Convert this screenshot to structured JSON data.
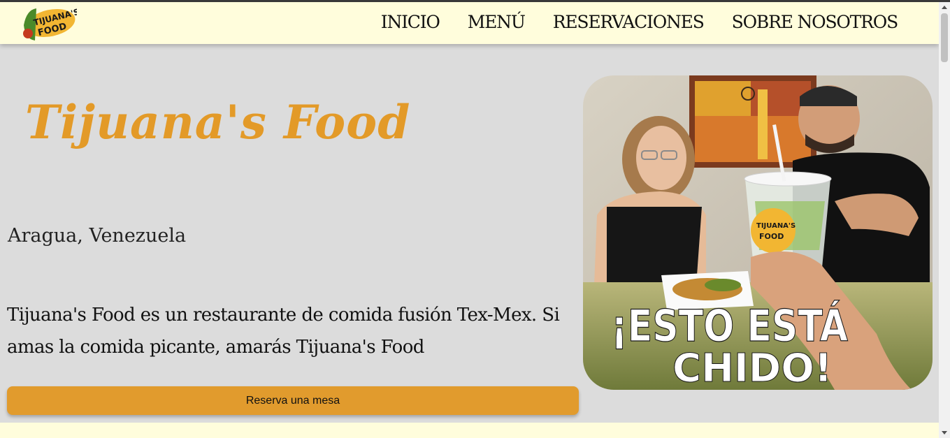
{
  "nav": {
    "logo": {
      "line1": "TIJUANA'S",
      "line2": "FOOD"
    },
    "links": [
      "INICIO",
      "MENÚ",
      "RESERVACIONES",
      "SOBRE NOSOTROS"
    ]
  },
  "hero": {
    "title": "Tijuana's Food",
    "location": "Aragua, Venezuela",
    "description": "Tijuana's Food es un restaurante de comida fusión Tex-Mex. Si amas la comida picante, amarás Tijuana's Food",
    "cta_label": "Reserva una mesa"
  },
  "photo": {
    "caption_line1": "¡ESTO ESTÁ",
    "caption_line2": "CHIDO!",
    "cup_label_line1": "TIJUANA'S",
    "cup_label_line2": "FOOD"
  },
  "colors": {
    "accent": "#e19b2d",
    "navbar_bg": "#fffddc",
    "page_bg": "#dcdcdc"
  }
}
